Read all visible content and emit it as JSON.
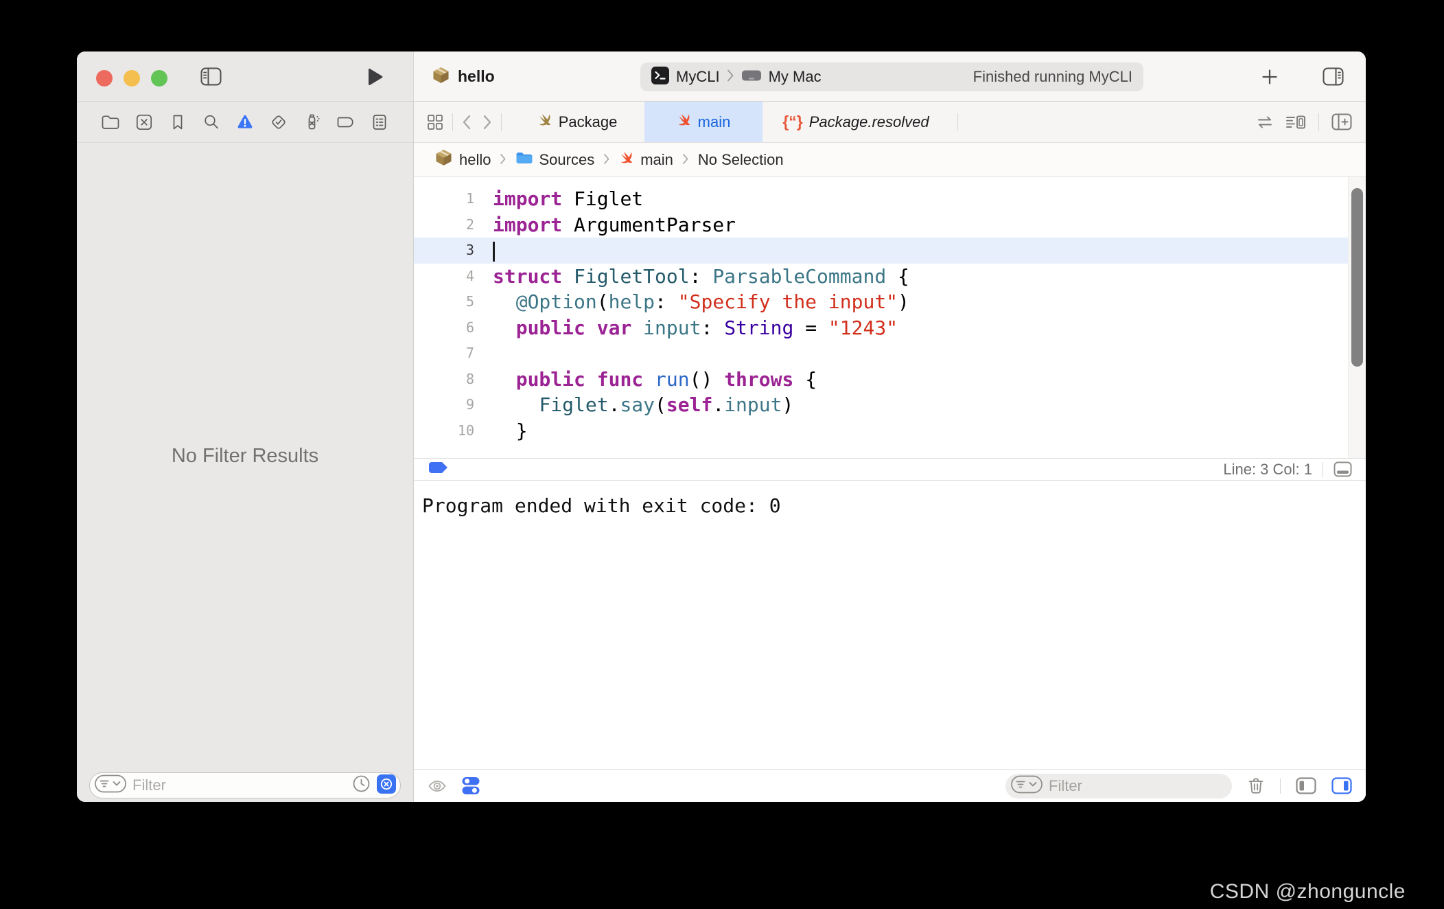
{
  "toolbar": {
    "project_title": "hello",
    "scheme_name": "MyCLI",
    "destination": "My Mac",
    "activity_status": "Finished running MyCLI"
  },
  "navigator": {
    "icons": [
      {
        "name": "project-navigator-icon",
        "selected": false
      },
      {
        "name": "source-control-navigator-icon",
        "selected": false
      },
      {
        "name": "bookmarks-navigator-icon",
        "selected": false
      },
      {
        "name": "find-navigator-icon",
        "selected": false
      },
      {
        "name": "issues-navigator-icon",
        "selected": true
      },
      {
        "name": "tests-navigator-icon",
        "selected": false
      },
      {
        "name": "debug-navigator-icon",
        "selected": false
      },
      {
        "name": "breakpoints-navigator-icon",
        "selected": false
      },
      {
        "name": "reports-navigator-icon",
        "selected": false
      }
    ],
    "empty_message": "No Filter Results",
    "filter_placeholder": "Filter"
  },
  "tabs": [
    {
      "label": "Package",
      "icon": "swift-gold",
      "active": false,
      "italic": false
    },
    {
      "label": "main",
      "icon": "swift-orange",
      "active": true,
      "italic": false
    },
    {
      "label": "Package.resolved",
      "icon": "json",
      "active": false,
      "italic": true
    }
  ],
  "breadcrumb": {
    "items": [
      {
        "label": "hello",
        "icon": "package-icon"
      },
      {
        "label": "Sources",
        "icon": "folder-blue-icon"
      },
      {
        "label": "main",
        "icon": "swift-orange"
      },
      {
        "label": "No Selection",
        "icon": null
      }
    ]
  },
  "editor": {
    "current_line": 3,
    "cursor": {
      "line": 3,
      "col": 1
    },
    "status_line_col": "Line: 3  Col: 1",
    "token_colors": {
      "plain": "#000000",
      "kw": "#9b2393",
      "typedecl": "#255a6b",
      "type": "#3c7687",
      "sdktype": "#3900a0",
      "str": "#d12f1b",
      "fn": "#2d68c9"
    },
    "lines": [
      {
        "num": 1,
        "tokens": [
          [
            "kw",
            "import"
          ],
          [
            "plain",
            " Figlet"
          ]
        ]
      },
      {
        "num": 2,
        "tokens": [
          [
            "kw",
            "import"
          ],
          [
            "plain",
            " ArgumentParser"
          ]
        ]
      },
      {
        "num": 3,
        "tokens": []
      },
      {
        "num": 4,
        "tokens": [
          [
            "kw",
            "struct"
          ],
          [
            "plain",
            " "
          ],
          [
            "typedecl",
            "FigletTool"
          ],
          [
            "plain",
            ": "
          ],
          [
            "type",
            "ParsableCommand"
          ],
          [
            "plain",
            " {"
          ]
        ]
      },
      {
        "num": 5,
        "tokens": [
          [
            "plain",
            "  "
          ],
          [
            "type",
            "@Option"
          ],
          [
            "plain",
            "("
          ],
          [
            "type",
            "help"
          ],
          [
            "plain",
            ": "
          ],
          [
            "str",
            "\"Specify the input\""
          ],
          [
            "plain",
            ")"
          ]
        ]
      },
      {
        "num": 6,
        "tokens": [
          [
            "plain",
            "  "
          ],
          [
            "kw",
            "public"
          ],
          [
            "plain",
            " "
          ],
          [
            "kw",
            "var"
          ],
          [
            "plain",
            " "
          ],
          [
            "type",
            "input"
          ],
          [
            "plain",
            ": "
          ],
          [
            "sdktype",
            "String"
          ],
          [
            "plain",
            " = "
          ],
          [
            "str",
            "\"1243\""
          ]
        ]
      },
      {
        "num": 7,
        "tokens": []
      },
      {
        "num": 8,
        "tokens": [
          [
            "plain",
            "  "
          ],
          [
            "kw",
            "public"
          ],
          [
            "plain",
            " "
          ],
          [
            "kw",
            "func"
          ],
          [
            "plain",
            " "
          ],
          [
            "fn",
            "run"
          ],
          [
            "plain",
            "() "
          ],
          [
            "kw",
            "throws"
          ],
          [
            "plain",
            " {"
          ]
        ]
      },
      {
        "num": 9,
        "tokens": [
          [
            "plain",
            "    "
          ],
          [
            "typedecl",
            "Figlet"
          ],
          [
            "plain",
            "."
          ],
          [
            "type",
            "say"
          ],
          [
            "plain",
            "("
          ],
          [
            "kw",
            "self"
          ],
          [
            "plain",
            "."
          ],
          [
            "type",
            "input"
          ],
          [
            "plain",
            ")"
          ]
        ]
      },
      {
        "num": 10,
        "tokens": [
          [
            "plain",
            "  }"
          ]
        ]
      }
    ]
  },
  "console": {
    "output": "Program ended with exit code: 0",
    "filter_placeholder": "Filter"
  },
  "watermark": "CSDN @zhonguncle",
  "colors": {
    "accent_blue": "#3a72f4",
    "tab_active_bg": "#d5e3fb",
    "tab_active_text": "#1a66dd",
    "swift_orange": "#f0512e",
    "swift_gold": "#9f8342",
    "current_line_bg": "#e8effc",
    "string_red": "#d12f1b",
    "keyword_pink": "#9b2393"
  }
}
